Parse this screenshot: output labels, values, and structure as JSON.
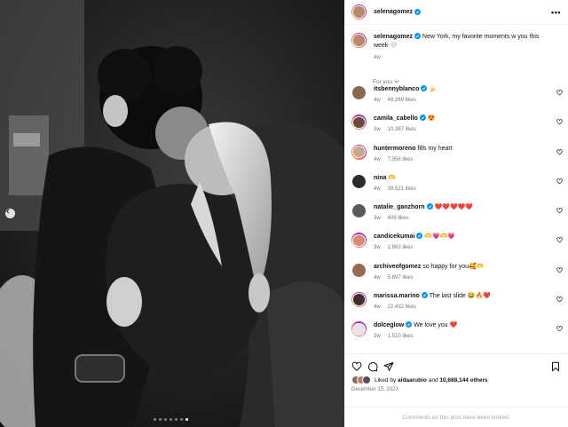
{
  "post": {
    "author": "selenagomez",
    "author_avatar_color": "#b38a6a",
    "caption_user": "selenagomez",
    "caption_text": "New York, my favorite moments w you this week 🤍",
    "caption_time": "4w",
    "more_icon": "more-horizontal-icon",
    "carousel": {
      "current": 7,
      "total": 7
    }
  },
  "for_you_label": "For you",
  "comments": [
    {
      "user": "itsbennyblanco",
      "verified": true,
      "text": "🍌",
      "time": "4w",
      "likes": "49.269 likes",
      "avatar_color": "#8a6a4a"
    },
    {
      "user": "camila_cabello",
      "verified": true,
      "text": "😍",
      "time": "3w",
      "likes": "10.387 likes",
      "avatar_color": "#6b4a3a",
      "ring": true
    },
    {
      "user": "huntermoreno",
      "verified": false,
      "text": "fills my heart",
      "time": "4w",
      "likes": "7.956 likes",
      "avatar_color": "#caa58a",
      "ring": true
    },
    {
      "user": "nina",
      "verified": false,
      "text": "🫶",
      "time": "4w",
      "likes": "38.521 likes",
      "avatar_color": "#2c2c2c"
    },
    {
      "user": "natalie_ganzhorn",
      "verified": true,
      "text": "❤️❤️❤️❤️❤️",
      "time": "3w",
      "likes": "409 likes",
      "avatar_color": "#5a5a5a"
    },
    {
      "user": "candicekumai",
      "verified": true,
      "text": "🫶💗🫶💗",
      "time": "3w",
      "likes": "1.863 likes",
      "avatar_color": "#d88a7a",
      "ring": true
    },
    {
      "user": "archiveofgomez",
      "verified": false,
      "text": "so happy for you🥰🫶",
      "time": "4w",
      "likes": "5.897 likes",
      "avatar_color": "#9a6a50"
    },
    {
      "user": "marissa.marino",
      "verified": true,
      "text": "The last slide 😂🔥❤️",
      "time": "4w",
      "likes": "22.432 likes",
      "avatar_color": "#3e3030",
      "ring": true
    },
    {
      "user": "dolceglow",
      "verified": true,
      "text": "We love you ❤️",
      "time": "3w",
      "likes": "1.510 likes",
      "avatar_color": "#e8e0e8",
      "ring": true
    }
  ],
  "actions": {
    "like_icon": "heart-icon",
    "comment_icon": "comment-icon",
    "share_icon": "share-icon",
    "save_icon": "bookmark-icon"
  },
  "likes_summary": {
    "prefix": "Liked by",
    "user": "aidaarubio",
    "middle": "and",
    "count": "10,688,144 others"
  },
  "date": "December 15, 2023",
  "comments_limited": "Comments on this post have been limited.",
  "colors": {
    "verified": "#0095f6",
    "muted": "#737373",
    "heart": "#ed4956"
  }
}
